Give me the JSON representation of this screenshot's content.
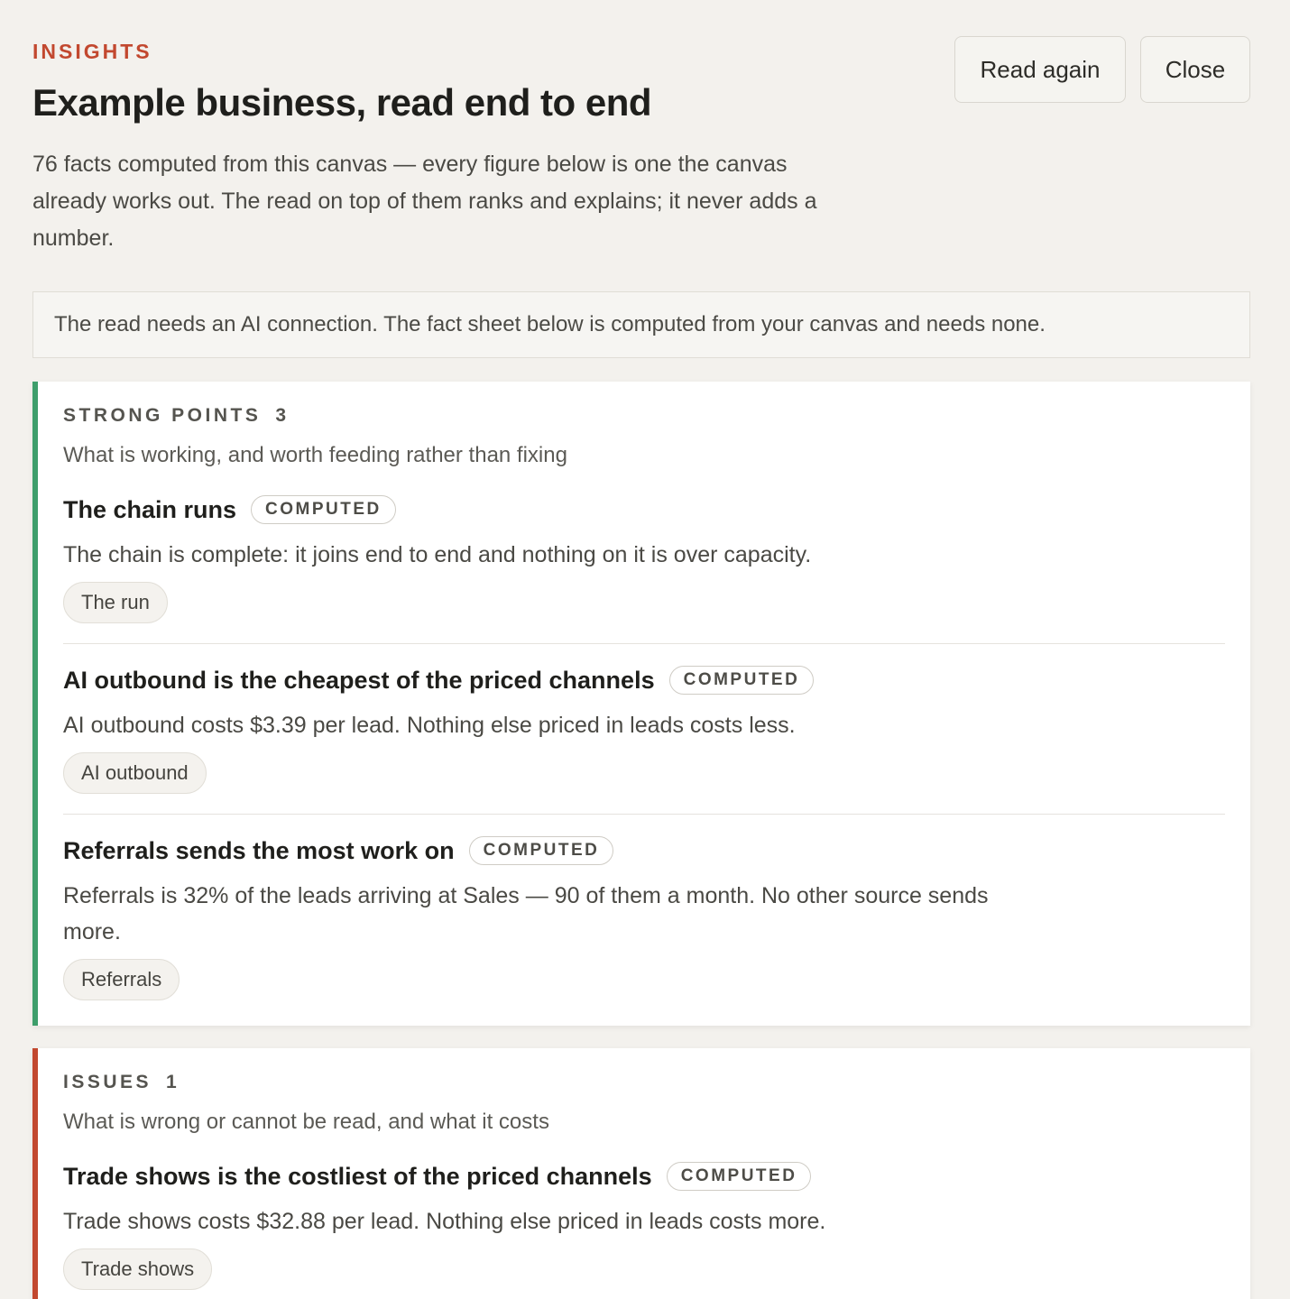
{
  "header": {
    "eyebrow": "INSIGHTS",
    "title": "Example business, read end to end",
    "intro": "76 facts computed from this canvas — every figure below is one the canvas already works out. The read on top of them ranks and explains; it never adds a number.",
    "actions": {
      "read_again": "Read again",
      "close": "Close"
    }
  },
  "notice": {
    "text": "The read needs an AI connection. The fact sheet below is computed from your canvas and needs none."
  },
  "strong_points": {
    "label": "STRONG POINTS",
    "count": "3",
    "subtitle": "What is working, and worth feeding rather than fixing",
    "accent_color": "#3e9e6b",
    "items": [
      {
        "title": "The chain runs",
        "badge": "COMPUTED",
        "body": "The chain is complete: it joins end to end and nothing on it is over capacity.",
        "chip": "The run"
      },
      {
        "title": "AI outbound is the cheapest of the priced channels",
        "badge": "COMPUTED",
        "body": "AI outbound costs $3.39 per lead. Nothing else priced in leads costs less.",
        "chip": "AI outbound"
      },
      {
        "title": "Referrals sends the most work on",
        "badge": "COMPUTED",
        "body": "Referrals is 32% of the leads arriving at Sales — 90 of them a month. No other source sends more.",
        "chip": "Referrals"
      }
    ]
  },
  "issues": {
    "label": "ISSUES",
    "count": "1",
    "subtitle": "What is wrong or cannot be read, and what it costs",
    "accent_color": "#c2482f",
    "items": [
      {
        "title": "Trade shows is the costliest of the priced channels",
        "badge": "COMPUTED",
        "body": "Trade shows costs $32.88 per lead. Nothing else priced in leads costs more.",
        "chip": "Trade shows"
      }
    ]
  }
}
